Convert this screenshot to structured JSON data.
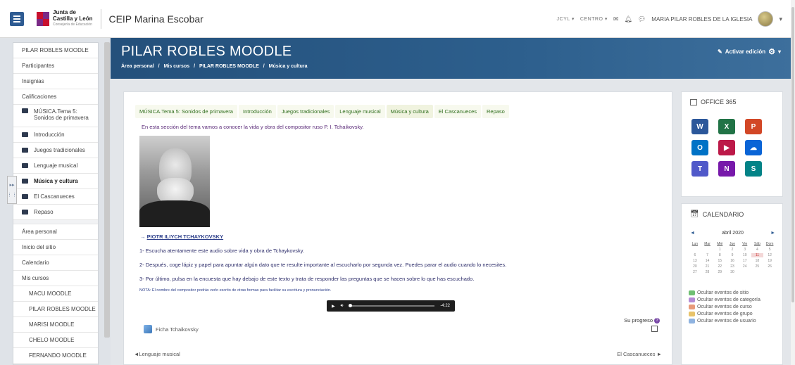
{
  "navbar": {
    "logo_line1": "Junta de",
    "logo_line2": "Castilla y León",
    "logo_line3": "Consejería de Educación",
    "site_title": "CEIP Marina Escobar",
    "links": [
      "JCYL ▾",
      "CENTRO ▾"
    ],
    "user_name": "MARIA PILAR ROBLES DE LA IGLESIA"
  },
  "drawer": {
    "course_items": [
      {
        "label": "PILAR ROBLES MOODLE",
        "icon": false
      },
      {
        "label": "Participantes",
        "icon": false
      },
      {
        "label": "Insignias",
        "icon": false
      },
      {
        "label": "Calificaciones",
        "icon": false
      }
    ],
    "section_items": [
      {
        "label": "MÚSICA.Tema 5: Sonidos de primavera"
      },
      {
        "label": "Introducción"
      },
      {
        "label": "Juegos tradicionales"
      },
      {
        "label": "Lenguaje musical"
      },
      {
        "label": "Música y cultura",
        "current": true
      },
      {
        "label": "El Cascanueces"
      },
      {
        "label": "Repaso"
      }
    ],
    "site_items": [
      "Área personal",
      "Inicio del sitio",
      "Calendario",
      "Mis cursos"
    ],
    "my_courses": [
      "MACU MOODLE",
      "PILAR ROBLES MOODLE",
      "MARISI MOODLE",
      "CHELO MOODLE",
      "FERNANDO MOODLE"
    ]
  },
  "header": {
    "title": "PILAR ROBLES MOODLE",
    "breadcrumb": [
      "Área personal",
      "/",
      "Mis cursos",
      "/",
      "PILAR ROBLES MOODLE",
      "/",
      "Música y cultura"
    ],
    "edit_label": "Activar edición"
  },
  "main": {
    "tabs": [
      "MÚSICA.Tema 5: Sonidos de primavera",
      "Introducción",
      "Juegos tradicionales",
      "Lenguaje musical",
      "Música y cultura",
      "El Cascanueces",
      "Repaso"
    ],
    "active_tab": "Música y cultura",
    "intro": "En esta sección del tema vamos a conocer la vida y obra del compositor ruso P. I. Tchaikovsky.",
    "composer_arrow": "→",
    "composer_name": "PIOTR ILIYCH TCHAYKOVSKY",
    "steps": [
      "1- Escucha atentamente este audio sobre vida y obra de Tchaykovsky.",
      "2- Después, coge lápiz y papel para apuntar algún dato que te resulte importante al escucharlo por segunda vez. Puedes parar el audio cuando lo necesites.",
      "3- Por último, pulsa en la encuesta que hay debajo de este texto y trata de responder las preguntas que se hacen sobre lo que has escuchado."
    ],
    "note": "NOTA: El nombre del compositor podrás verlo escrito de otras formas para facilitar su escritura y pronunciación.",
    "audio_time": "-4:22",
    "progress_label": "Su progreso",
    "resource_label": "Ficha Tchaikovsky",
    "prev_link": "◄Lenguaje musical",
    "next_link": "El Cascanueces ►"
  },
  "office": {
    "title": "OFFICE 365",
    "apps": [
      {
        "icon": "word-icon",
        "letter": "W",
        "color": "#2b579a"
      },
      {
        "icon": "excel-icon",
        "letter": "X",
        "color": "#217346"
      },
      {
        "icon": "powerpoint-icon",
        "letter": "P",
        "color": "#d24726"
      },
      {
        "icon": "outlook-icon",
        "letter": "O",
        "color": "#0072c6"
      },
      {
        "icon": "stream-icon",
        "letter": "▶",
        "color": "#bc1948"
      },
      {
        "icon": "onedrive-icon",
        "letter": "☁",
        "color": "#0a64d6"
      },
      {
        "icon": "teams-icon",
        "letter": "T",
        "color": "#5059c9"
      },
      {
        "icon": "onenote-icon",
        "letter": "N",
        "color": "#7719aa"
      },
      {
        "icon": "sharepoint-icon",
        "letter": "S",
        "color": "#038387"
      }
    ]
  },
  "calendar": {
    "title": "CALENDARIO",
    "month": "abril 2020",
    "day_headers": [
      "Lun",
      "Mar",
      "Mié",
      "Jue",
      "Vie",
      "Sáb",
      "Dom"
    ],
    "days": [
      "",
      "",
      "1",
      "2",
      "3",
      "4",
      "5",
      "6",
      "7",
      "8",
      "9",
      "10",
      "11",
      "12",
      "13",
      "14",
      "15",
      "16",
      "17",
      "18",
      "19",
      "20",
      "21",
      "22",
      "23",
      "24",
      "25",
      "26",
      "27",
      "28",
      "29",
      "30",
      "",
      "",
      ""
    ],
    "today": "11",
    "events": [
      {
        "label": "Ocultar eventos de sitio",
        "color": "#6fbf73"
      },
      {
        "label": "Ocultar eventos de categoría",
        "color": "#b38ad6"
      },
      {
        "label": "Ocultar eventos de curso",
        "color": "#e89a7a"
      },
      {
        "label": "Ocultar eventos de grupo",
        "color": "#e8c36a"
      },
      {
        "label": "Ocultar eventos de usuario",
        "color": "#8fb3e0"
      }
    ]
  }
}
